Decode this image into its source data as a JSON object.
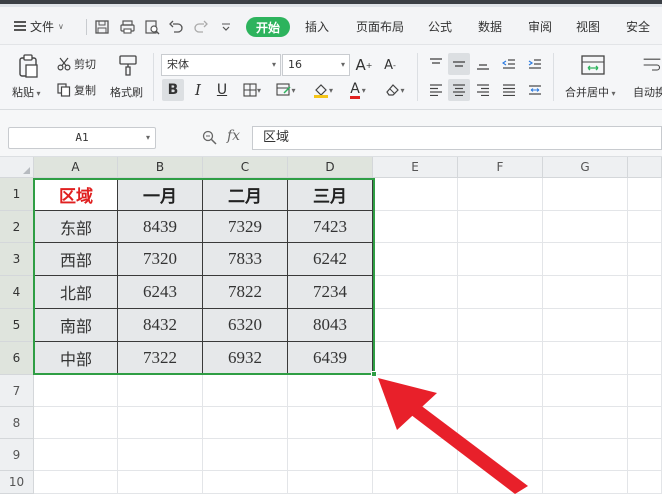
{
  "menubar": {
    "file_label": "文件",
    "active_tab": "开始",
    "tabs": [
      "插入",
      "页面布局",
      "公式",
      "数据",
      "审阅",
      "视图",
      "安全"
    ]
  },
  "ribbon": {
    "paste": "粘贴",
    "cut": "剪切",
    "copy": "复制",
    "format_painter": "格式刷",
    "font_name": "宋体",
    "font_size": "16",
    "merge_center": "合并居中",
    "auto_wrap": "自动换"
  },
  "formula_bar": {
    "cell_ref": "A1",
    "fx": "fx",
    "content": "区域"
  },
  "grid": {
    "columns": [
      "A",
      "B",
      "C",
      "D",
      "E",
      "F",
      "G"
    ],
    "rows": [
      "1",
      "2",
      "3",
      "4",
      "5",
      "6",
      "7",
      "8",
      "9",
      "10"
    ],
    "header_row": [
      "区域",
      "一月",
      "二月",
      "三月"
    ],
    "data_rows": [
      [
        "东部",
        "8439",
        "7329",
        "7423"
      ],
      [
        "西部",
        "7320",
        "7833",
        "6242"
      ],
      [
        "北部",
        "6243",
        "7822",
        "7234"
      ],
      [
        "南部",
        "8432",
        "6320",
        "8043"
      ],
      [
        "中部",
        "7322",
        "6932",
        "6439"
      ]
    ]
  },
  "colors": {
    "accent_green": "#2db35d",
    "selection_green": "#2f9e44",
    "header_red": "#e02020",
    "arrow_red": "#e8202a"
  },
  "icons": {
    "menu": "hamburger-icon",
    "save": "save-icon",
    "print": "print-icon",
    "preview": "print-preview-icon",
    "undo": "undo-icon",
    "redo": "redo-icon",
    "annotation": "red-arrow-pointer"
  }
}
